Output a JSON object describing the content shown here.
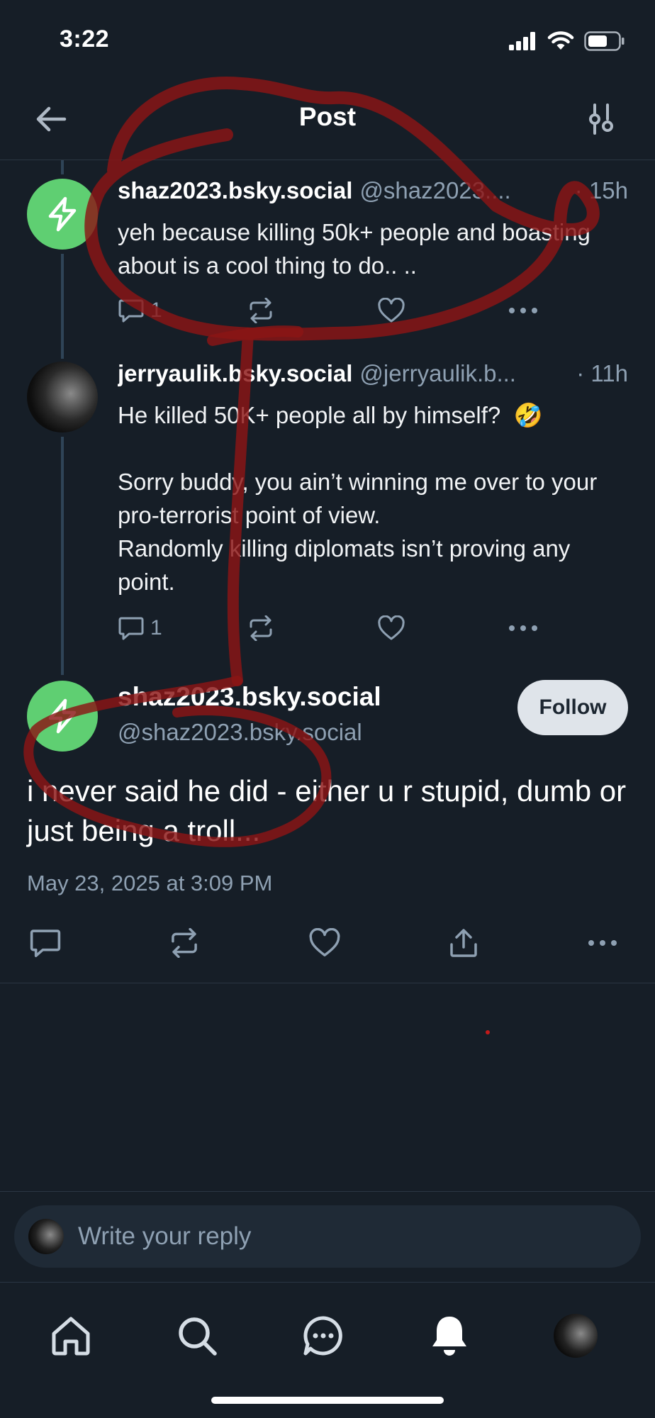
{
  "status_bar": {
    "time": "3:22"
  },
  "header": {
    "title": "Post"
  },
  "thread": [
    {
      "display_name": "shaz2023.bsky.social",
      "handle": "@shaz2023....",
      "time": "· 15h",
      "text": "yeh because killing 50k+ people and boasting about is a cool thing to do.. ..",
      "reply_count": "1",
      "avatar": "lightning-bolt-avatar"
    },
    {
      "display_name": "jerryaulik.bsky.social",
      "handle": "@jerryaulik.b...",
      "time": "· 11h",
      "text": "He killed 50K+ people all by himself?  🤣\n\nSorry buddy, you ain’t winning me over to your pro-terrorist point of view.\nRandomly killing diplomats isn’t proving any point.",
      "reply_count": "1",
      "avatar": "photo-avatar"
    }
  ],
  "main_post": {
    "display_name": "shaz2023.bsky.social",
    "handle": "@shaz2023.bsky.social",
    "follow_label": "Follow",
    "text": "i never said he did - either u r stupid, dumb or just being a troll...",
    "date": "May 23, 2025 at 3:09 PM"
  },
  "reply": {
    "placeholder": "Write your reply"
  },
  "tabbar": [
    "home-icon",
    "search-icon",
    "chat-icon",
    "bell-icon",
    "profile-avatar"
  ],
  "colors": {
    "background": "#161e27",
    "muted_text": "#8ea0b2",
    "avatar_green": "#5fcf72",
    "annotation_red": "#8b1515"
  }
}
